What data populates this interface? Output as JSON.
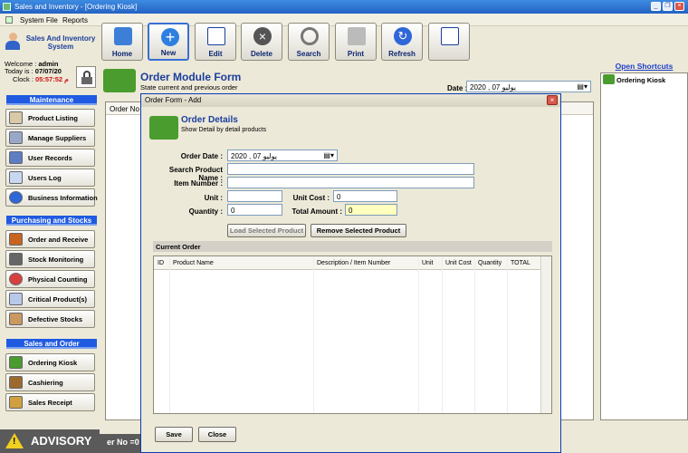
{
  "window": {
    "title": "Sales and Inventory - [Ordering Kiosk]"
  },
  "menu": [
    "System File",
    "Reports"
  ],
  "app_title": "Sales And Inventory System",
  "user": {
    "welcome_label": "Welcome :",
    "welcome_value": "admin",
    "today_label": "Today is :",
    "today_value": "07/07/20",
    "clock_label": "Clock :",
    "clock_value": "05:57:52 م"
  },
  "sidebar": {
    "sections": [
      "Maintenance",
      "Purchasing and Stocks",
      "Sales and Order"
    ],
    "maintenance": [
      "Product Listing",
      "Manage Suppliers",
      "User Records",
      "Users Log",
      "Business Information"
    ],
    "purchasing": [
      "Order and Receive",
      "Stock Monitoring",
      "Physical Counting",
      "Critical Product(s)",
      "Defective Stocks"
    ],
    "sales": [
      "Ordering Kiosk",
      "Cashiering",
      "Sales Receipt"
    ]
  },
  "advisory": "ADVISORY",
  "status_message": "er No =0",
  "toolbar": [
    "Home",
    "New",
    "Edit",
    "Delete",
    "Search",
    "Print",
    "Refresh"
  ],
  "module": {
    "title": "Order Module Form",
    "subtitle": "State current and previous order",
    "date_label": "Date :",
    "date_value": "2020 ,   يوليو   07",
    "col_order_no": "Order No"
  },
  "shortcuts": {
    "title": "Open Shortcuts",
    "items": [
      "Ordering Kiosk"
    ]
  },
  "dialog": {
    "title": "Order Form - Add",
    "header": "Order Details",
    "subheader": "Show Detail by detail products",
    "labels": {
      "order_date": "Order Date :",
      "search_product": "Search Product Name :",
      "item_number": "Item Number :",
      "unit": "Unit :",
      "unit_cost": "Unit Cost :",
      "quantity": "Quantity :",
      "total_amount": "Total Amount :"
    },
    "values": {
      "order_date": "2020 ,   يوليو   07",
      "search_product": "",
      "item_number": "",
      "unit": "",
      "unit_cost": "0",
      "quantity": "0",
      "total_amount": "0"
    },
    "load_button": "Load Selected Product",
    "remove_button": "Remove Selected Product",
    "current_order": "Current Order",
    "columns": [
      "ID",
      "Product Name",
      "Description / Item Number",
      "Unit",
      "Unit Cost",
      "Quantity",
      "TOTAL"
    ],
    "save_button": "Save",
    "close_button": "Close"
  },
  "colors": {
    "titlebar": "#2462c4",
    "section": "#1f5ae0",
    "accent_text": "#1c3e9e",
    "highlight_field": "#ffffc0"
  }
}
